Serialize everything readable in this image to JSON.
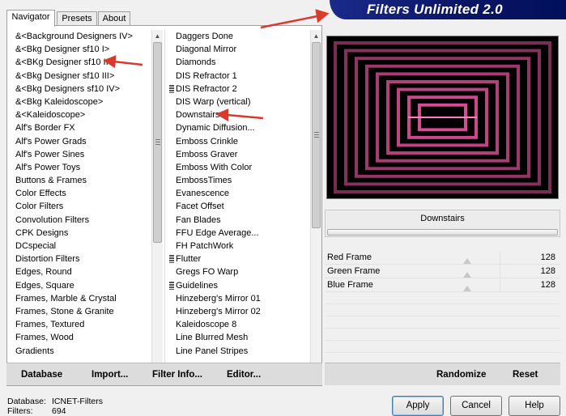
{
  "tabs": [
    "Navigator",
    "Presets",
    "About"
  ],
  "banner_title": "Filters Unlimited 2.0",
  "categories": [
    {
      "label": "&<Background Designers IV>"
    },
    {
      "label": "&<Bkg Designer sf10 I>"
    },
    {
      "label": "&<BKg Designer sf10 II>"
    },
    {
      "label": "&<Bkg Designer sf10 III>"
    },
    {
      "label": "&<Bkg Designers sf10 IV>"
    },
    {
      "label": "&<Bkg Kaleidoscope>"
    },
    {
      "label": "&<Kaleidoscope>"
    },
    {
      "label": "Alf's Border FX"
    },
    {
      "label": "Alf's Power Grads"
    },
    {
      "label": "Alf's Power Sines"
    },
    {
      "label": "Alf's Power Toys"
    },
    {
      "label": "Buttons & Frames"
    },
    {
      "label": "Color Effects"
    },
    {
      "label": "Color Filters"
    },
    {
      "label": "Convolution Filters"
    },
    {
      "label": "CPK Designs"
    },
    {
      "label": "DCspecial"
    },
    {
      "label": "Distortion Filters"
    },
    {
      "label": "Edges, Round"
    },
    {
      "label": "Edges, Square"
    },
    {
      "label": "Frames, Marble & Crystal"
    },
    {
      "label": "Frames, Stone & Granite"
    },
    {
      "label": "Frames, Textured"
    },
    {
      "label": "Frames, Wood"
    },
    {
      "label": "Gradients"
    }
  ],
  "filters": [
    {
      "label": "Daggers Done",
      "grip": false
    },
    {
      "label": "Diagonal Mirror",
      "grip": false
    },
    {
      "label": "Diamonds",
      "grip": false
    },
    {
      "label": "DIS Refractor 1",
      "grip": false
    },
    {
      "label": "DIS Refractor 2",
      "grip": true
    },
    {
      "label": "DIS Warp (vertical)",
      "grip": false
    },
    {
      "label": "Downstairs",
      "grip": false
    },
    {
      "label": "Dynamic Diffusion...",
      "grip": false
    },
    {
      "label": "Emboss Crinkle",
      "grip": false
    },
    {
      "label": "Emboss Graver",
      "grip": false
    },
    {
      "label": "Emboss With Color",
      "grip": false
    },
    {
      "label": "EmbossTimes",
      "grip": false
    },
    {
      "label": "Evanescence",
      "grip": false
    },
    {
      "label": "Facet Offset",
      "grip": false
    },
    {
      "label": "Fan Blades",
      "grip": false
    },
    {
      "label": "FFU Edge Average...",
      "grip": false
    },
    {
      "label": "FH PatchWork",
      "grip": false
    },
    {
      "label": "Flutter",
      "grip": true
    },
    {
      "label": "Gregs FO Warp",
      "grip": false
    },
    {
      "label": "Guidelines",
      "grip": true
    },
    {
      "label": "Hinzeberg's Mirror 01",
      "grip": false
    },
    {
      "label": "Hinzeberg's Mirror 02",
      "grip": false
    },
    {
      "label": "Kaleidoscope 8",
      "grip": false
    },
    {
      "label": "Line Blurred Mesh",
      "grip": false
    },
    {
      "label": "Line Panel Stripes",
      "grip": false
    }
  ],
  "left_buttons": {
    "database": "Database",
    "import": "Import...",
    "filter_info": "Filter Info...",
    "editor": "Editor..."
  },
  "selected_filter": "Downstairs",
  "sliders": [
    {
      "label": "Red Frame",
      "value": "128",
      "level": 128
    },
    {
      "label": "Green Frame",
      "value": "128",
      "level": 128
    },
    {
      "label": "Blue Frame",
      "value": "128",
      "level": 128
    }
  ],
  "right_buttons": {
    "randomize": "Randomize",
    "reset": "Reset"
  },
  "status": {
    "database_label": "Database:",
    "database_value": "ICNET-Filters",
    "filters_label": "Filters:",
    "filters_value": "694"
  },
  "dialog_buttons": {
    "apply": "Apply",
    "cancel": "Cancel",
    "help": "Help"
  },
  "colors": {
    "banner": "#0a1464",
    "preview_pink": "#e0509a",
    "annotation_arrow": "#d93a2b"
  }
}
